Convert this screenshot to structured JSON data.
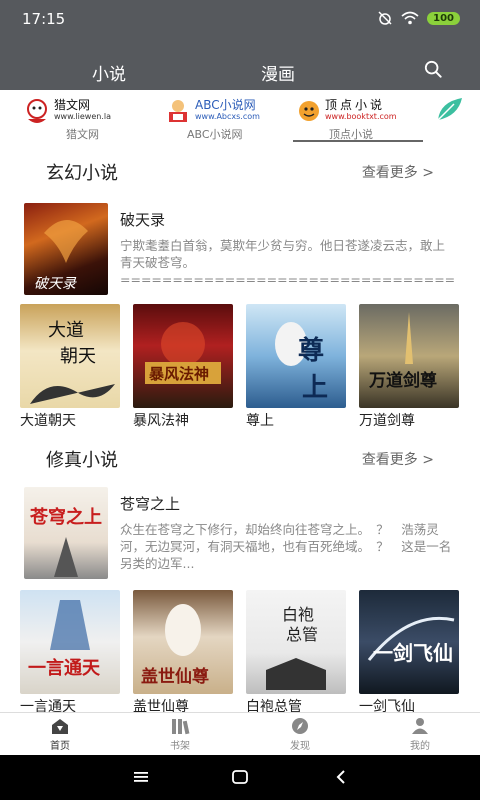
{
  "status": {
    "time": "17:15",
    "battery": "100"
  },
  "top_tabs": [
    {
      "label": "小说",
      "active": true
    },
    {
      "label": "漫画",
      "active": false
    }
  ],
  "sources": [
    {
      "logo_text": "猎文网",
      "logo_sub": "www.liewen.la",
      "label": "猎文网"
    },
    {
      "logo_text": "ABC小说网",
      "logo_sub": "www.Abcxs.com",
      "label": "ABC小说网"
    },
    {
      "logo_text": "顶点小说",
      "logo_sub": "www.booktxt.com",
      "label": "顶点小说"
    }
  ],
  "sections": [
    {
      "title": "玄幻小说",
      "more": "查看更多 >",
      "featured": {
        "title": "破天录",
        "desc": "宁欺耄耋白首翁，莫欺年少贫与穷。他日苍遂凌云志，敢上青天破苍穹。=================================================== 2..."
      },
      "books": [
        "大道朝天",
        "暴风法神",
        "尊上",
        "万道剑尊"
      ]
    },
    {
      "title": "修真小说",
      "more": "查看更多 >",
      "featured": {
        "title": "苍穹之上",
        "desc": "众生在苍穹之下修行，却始终向往苍穹之上。　？　浩荡灵河，无边冥河，有洞天福地，也有百死绝域。　？　这是一名另类的边军..."
      },
      "books": [
        "一言通天",
        "盖世仙尊",
        "白袍总管",
        "一剑飞仙"
      ]
    }
  ],
  "bottom_nav": [
    {
      "label": "首页",
      "icon": "home-icon",
      "active": true
    },
    {
      "label": "书架",
      "icon": "bookshelf-icon",
      "active": false
    },
    {
      "label": "发现",
      "icon": "compass-icon",
      "active": false
    },
    {
      "label": "我的",
      "icon": "user-icon",
      "active": false
    }
  ]
}
